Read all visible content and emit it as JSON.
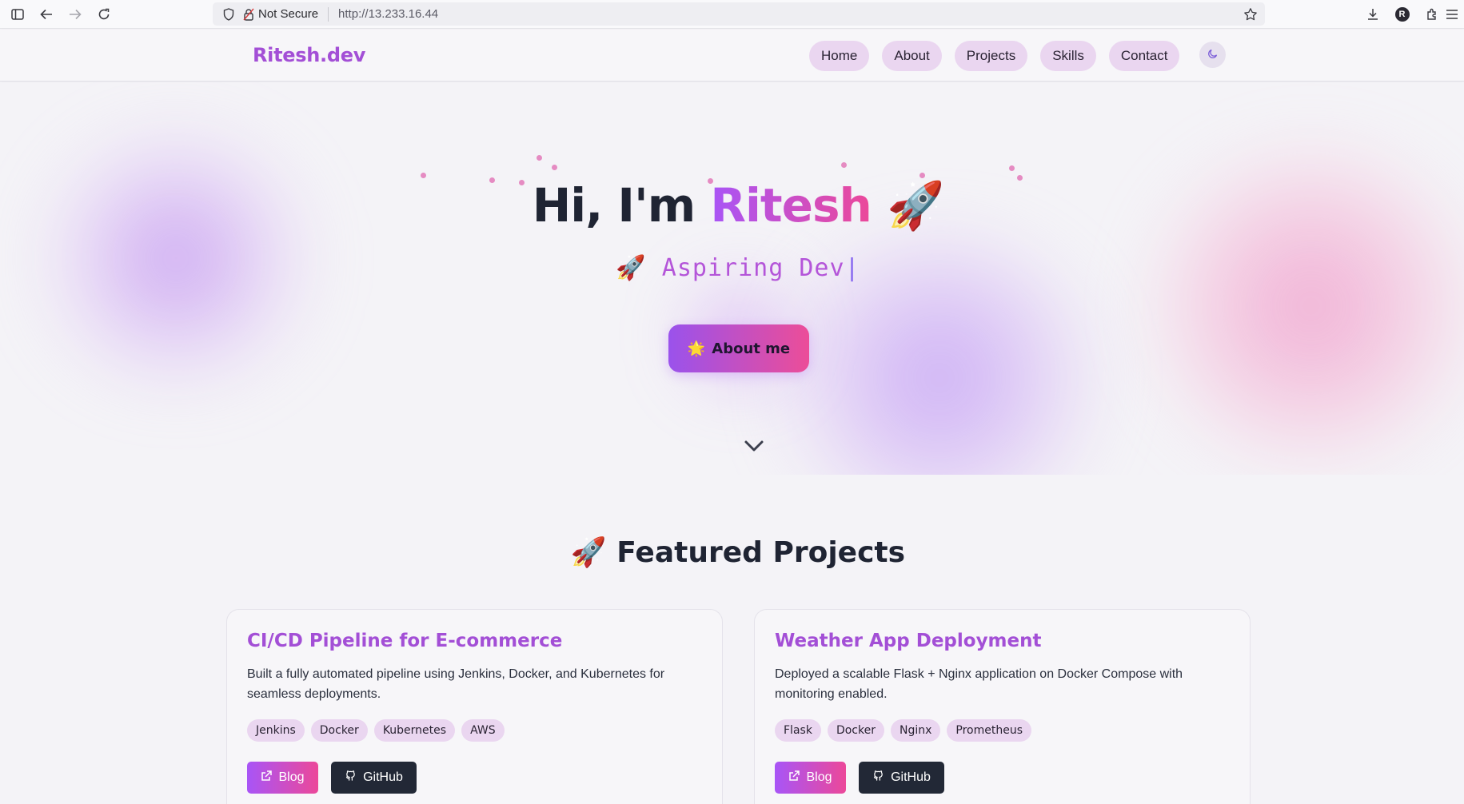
{
  "browser": {
    "not_secure_label": "Not Secure",
    "url": "http://13.233.16.44",
    "profile_initial": "R",
    "icons": [
      "sidebar-icon",
      "back-icon",
      "forward-icon",
      "reload-icon",
      "shield-icon",
      "insecure-lock-icon",
      "bookmark-star-icon",
      "download-icon",
      "extensions-icon",
      "menu-icon"
    ]
  },
  "nav": {
    "brand": "Ritesh.dev",
    "links": [
      {
        "label": "Home"
      },
      {
        "label": "About"
      },
      {
        "label": "Projects"
      },
      {
        "label": "Skills"
      },
      {
        "label": "Contact"
      }
    ],
    "theme_icon": "moon-icon"
  },
  "hero": {
    "greeting": "Hi, I'm ",
    "name": "Ritesh",
    "title_emoji": "🚀",
    "subtitle_emoji": "🚀",
    "subtitle": "Aspiring Dev",
    "cursor": "|",
    "cta_emoji": "🌟",
    "cta_label": "About me",
    "scroll_icon": "chevron-down-icon"
  },
  "projects": {
    "section_emoji": "🚀",
    "section_title": "Featured Projects",
    "items": [
      {
        "title": "CI/CD Pipeline for E-commerce",
        "description": "Built a fully automated pipeline using Jenkins, Docker, and Kubernetes for seamless deployments.",
        "tags": [
          "Jenkins",
          "Docker",
          "Kubernetes",
          "AWS"
        ],
        "blog_label": "Blog",
        "github_label": "GitHub"
      },
      {
        "title": "Weather App Deployment",
        "description": "Deployed a scalable Flask + Nginx application on Docker Compose with monitoring enabled.",
        "tags": [
          "Flask",
          "Docker",
          "Nginx",
          "Prometheus"
        ],
        "blog_label": "Blog",
        "github_label": "GitHub"
      }
    ]
  },
  "colors": {
    "accent_purple": "#a855f7",
    "accent_pink": "#ec4899",
    "pill_bg": "#ead6f0",
    "dark_button": "#222836"
  }
}
